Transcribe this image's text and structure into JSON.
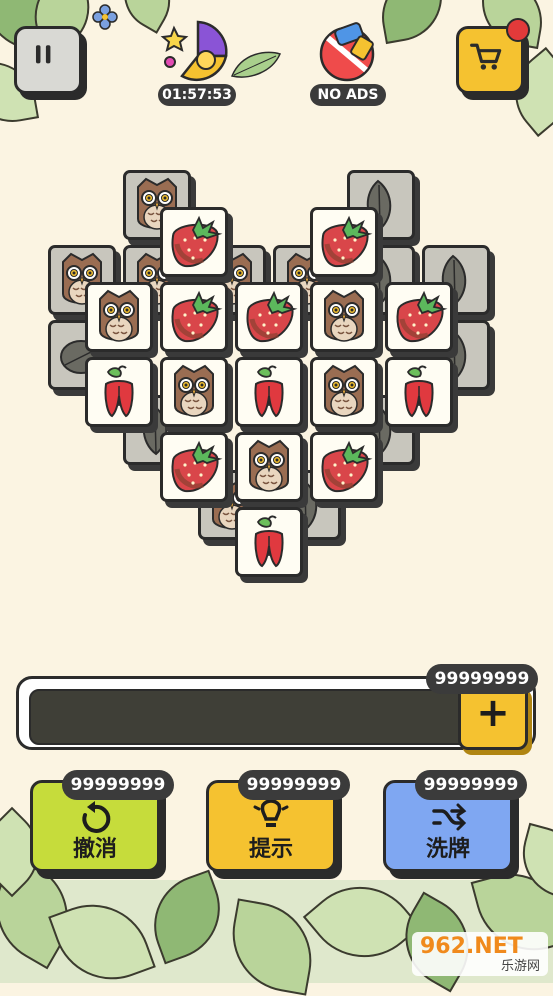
{
  "header": {
    "timer": "01:57:53",
    "no_ads_label": "NO ADS"
  },
  "tray": {
    "add_count": "99999999",
    "add_symbol": "+"
  },
  "tools": [
    {
      "label": "撤消",
      "count": "99999999",
      "icon": "undo-icon",
      "color": "#c6dc3b"
    },
    {
      "label": "提示",
      "count": "99999999",
      "icon": "lightbulb-icon",
      "color": "#f5c230"
    },
    {
      "label": "洗牌",
      "count": "99999999",
      "icon": "shuffle-icon",
      "color": "#7fa7f2"
    }
  ],
  "watermark": {
    "brand": "962.NET",
    "sub": "乐游网"
  },
  "colors": {
    "background": "#fbf4e2",
    "tile_face": "#fffdf3",
    "tile_dim": "#c8c6bd",
    "accent_yellow": "#f5c230",
    "undo_green": "#c6dc3b",
    "shuffle_blue": "#7fa7f2"
  },
  "board": {
    "tile_types": [
      "owl",
      "strawberry",
      "flower",
      "leaf",
      "leaf-round"
    ]
  }
}
